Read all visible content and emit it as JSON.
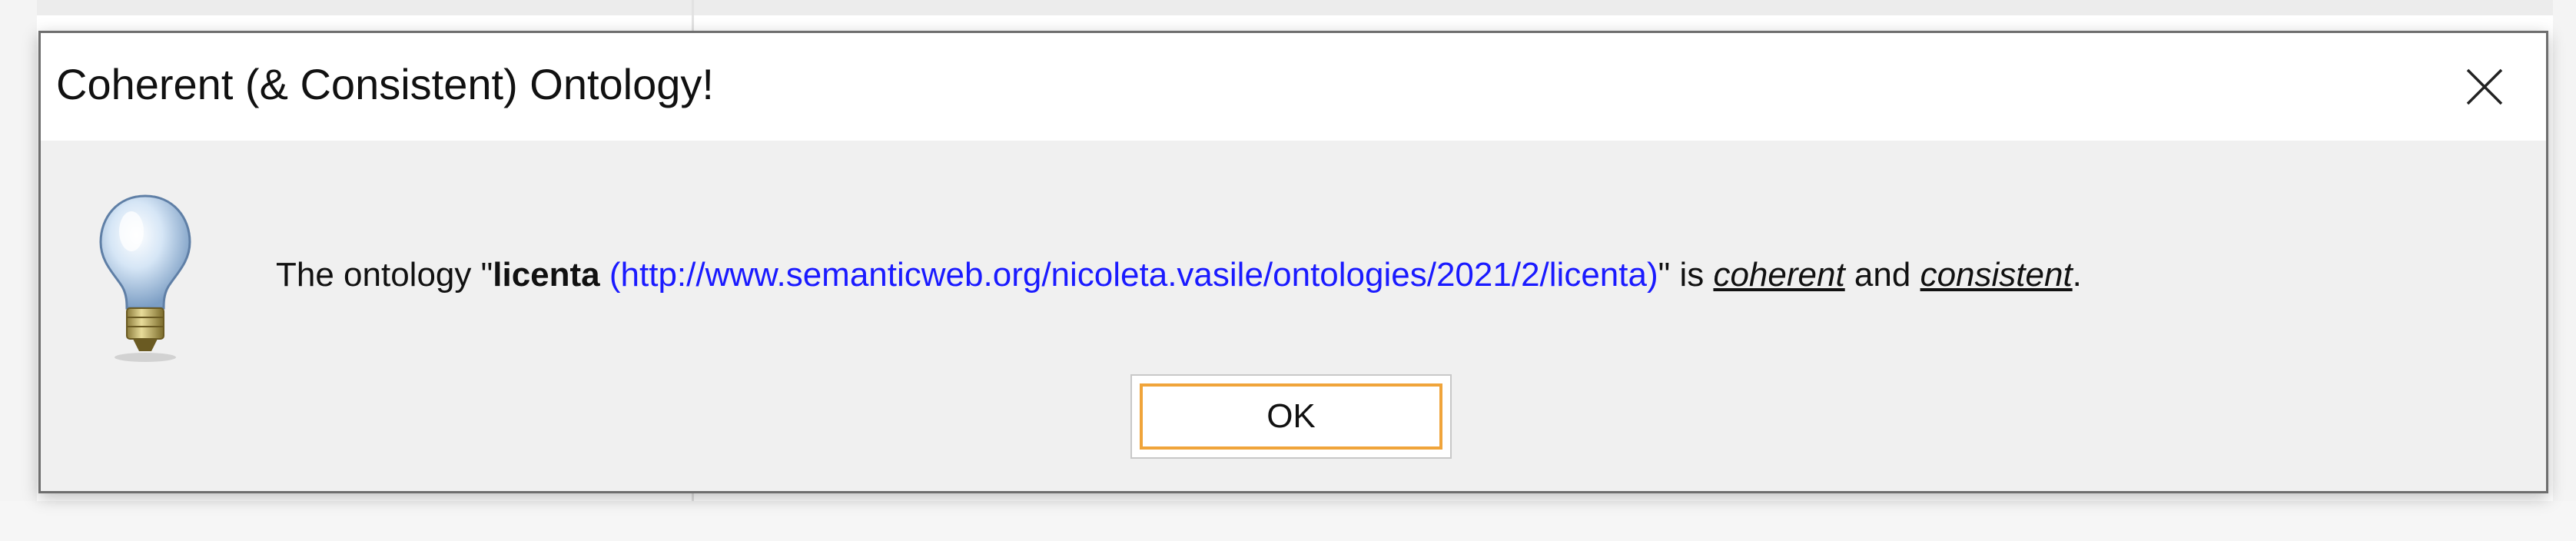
{
  "dialog": {
    "title": "Coherent (& Consistent) Ontology!",
    "close_icon": "close-icon",
    "info_icon": "light-bulb-icon",
    "message": {
      "prefix": "The ontology \"",
      "ontology_name": "licenta",
      "ontology_iri": "(http://www.semanticweb.org/nicoleta.vasile/ontologies/2021/2/licenta)",
      "middle": "\" is ",
      "term_coherent": "coherent",
      "conjunction": " and ",
      "term_consistent": "consistent",
      "suffix": "."
    },
    "ok_label": "OK"
  },
  "colors": {
    "iri_link": "#1a1aff",
    "ok_focus_border": "#f0a43a",
    "dialog_body": "#f0f0f0",
    "titlebar": "#ffffff"
  }
}
